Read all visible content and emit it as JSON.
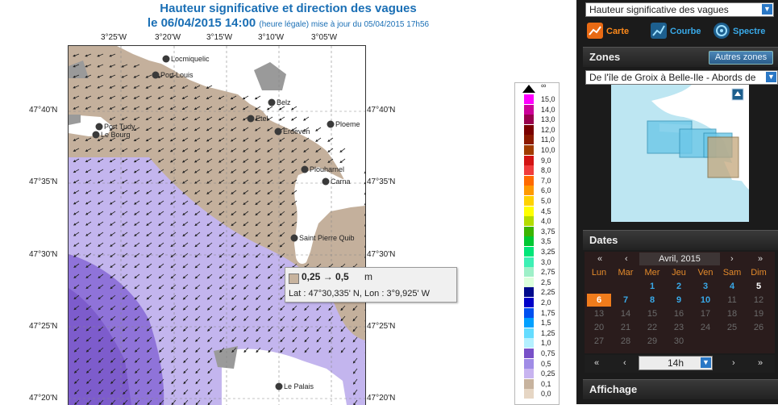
{
  "header": {
    "title": "Hauteur significative et direction des vagues",
    "date_main": "le 06/04/2015 14:00",
    "date_note": "(heure légale) mise à jour du 05/04/2015 17h56"
  },
  "axes": {
    "lon_top": [
      "3°25'W",
      "3°20'W",
      "3°15'W",
      "3°10'W",
      "3°05'W"
    ],
    "lat_left": [
      "47°40'N",
      "47°35'N",
      "47°30'N",
      "47°25'N",
      "47°20'N"
    ],
    "lat_right": [
      "47°40'N",
      "47°35'N",
      "47°30'N",
      "47°25'N",
      "47°20'N"
    ]
  },
  "towns": [
    {
      "name": "Locmiquelic"
    },
    {
      "name": "Port Louis"
    },
    {
      "name": "Belz"
    },
    {
      "name": "Etel"
    },
    {
      "name": "Port Tudy"
    },
    {
      "name": "Le Bourg"
    },
    {
      "name": "Erdeven"
    },
    {
      "name": "Ploeme"
    },
    {
      "name": "Plouharnel"
    },
    {
      "name": "Carna"
    },
    {
      "name": "Saint Pierre Quib"
    },
    {
      "name": "Le Palais"
    }
  ],
  "tooltip": {
    "range": "0,25 → 0,5",
    "unit": "m",
    "coords": "Lat : 47°30,335' N, Lon : 3°9,925' W",
    "swatch_color": "#c7b39e"
  },
  "legend": {
    "top_symbol": "∞",
    "labels": [
      "15,0",
      "14,0",
      "13,0",
      "12,0",
      "11,0",
      "10,0",
      "9,0",
      "8,0",
      "7,0",
      "6,0",
      "5,0",
      "4,5",
      "4,0",
      "3,75",
      "3,5",
      "3,25",
      "3,0",
      "2,75",
      "2,5",
      "2,25",
      "2,0",
      "1,75",
      "1,5",
      "1,25",
      "1,0",
      "0,75",
      "0,5",
      "0,25",
      "0,1",
      "0,0"
    ],
    "colors": [
      "#ff00ff",
      "#cc0099",
      "#99004d",
      "#7a0000",
      "#8c1a00",
      "#a03c00",
      "#d21414",
      "#f03c3c",
      "#ff6a00",
      "#ff9a00",
      "#ffd200",
      "#ffff00",
      "#b4dc00",
      "#3cb400",
      "#00c832",
      "#00e678",
      "#3cf0b4",
      "#9ef0c8",
      "#dcffdc",
      "#000a8c",
      "#0000c8",
      "#0050f0",
      "#00a0ff",
      "#64dcff",
      "#b4f0ff",
      "#7850c8",
      "#a08ce6",
      "#c8b4f0",
      "#c7b39e",
      "#e6d6c4"
    ]
  },
  "panel": {
    "param_select": "Hauteur significative des vagues",
    "views": [
      {
        "label": "Carte",
        "icon": "map-icon"
      },
      {
        "label": "Courbe",
        "icon": "curve-icon"
      },
      {
        "label": "Spectre",
        "icon": "spectrum-icon"
      }
    ],
    "zones_title": "Zones",
    "other_zones": "Autres zones",
    "zone_select": "De l'île de Groix à Belle-Ile - Abords de",
    "dates_title": "Dates",
    "cal_prev_year": "«",
    "cal_prev_month": "‹",
    "cal_month": "Avril, 2015",
    "cal_next_month": "›",
    "cal_next_year": "»",
    "weekdays": [
      "Lun",
      "Mar",
      "Mer",
      "Jeu",
      "Ven",
      "Sam",
      "Dim"
    ],
    "weeks": [
      [
        "",
        "",
        "1",
        "2",
        "3",
        "4",
        "5"
      ],
      [
        "6",
        "7",
        "8",
        "9",
        "10",
        "11",
        "12"
      ],
      [
        "13",
        "14",
        "15",
        "16",
        "17",
        "18",
        "19"
      ],
      [
        "20",
        "21",
        "22",
        "23",
        "24",
        "25",
        "26"
      ],
      [
        "27",
        "28",
        "29",
        "30",
        "",
        "",
        ""
      ]
    ],
    "selected_day": "6",
    "hour_prev2": "«",
    "hour_prev": "‹",
    "hour_value": "14h",
    "hour_next": "›",
    "hour_next2": "»",
    "affichage_title": "Affichage"
  }
}
